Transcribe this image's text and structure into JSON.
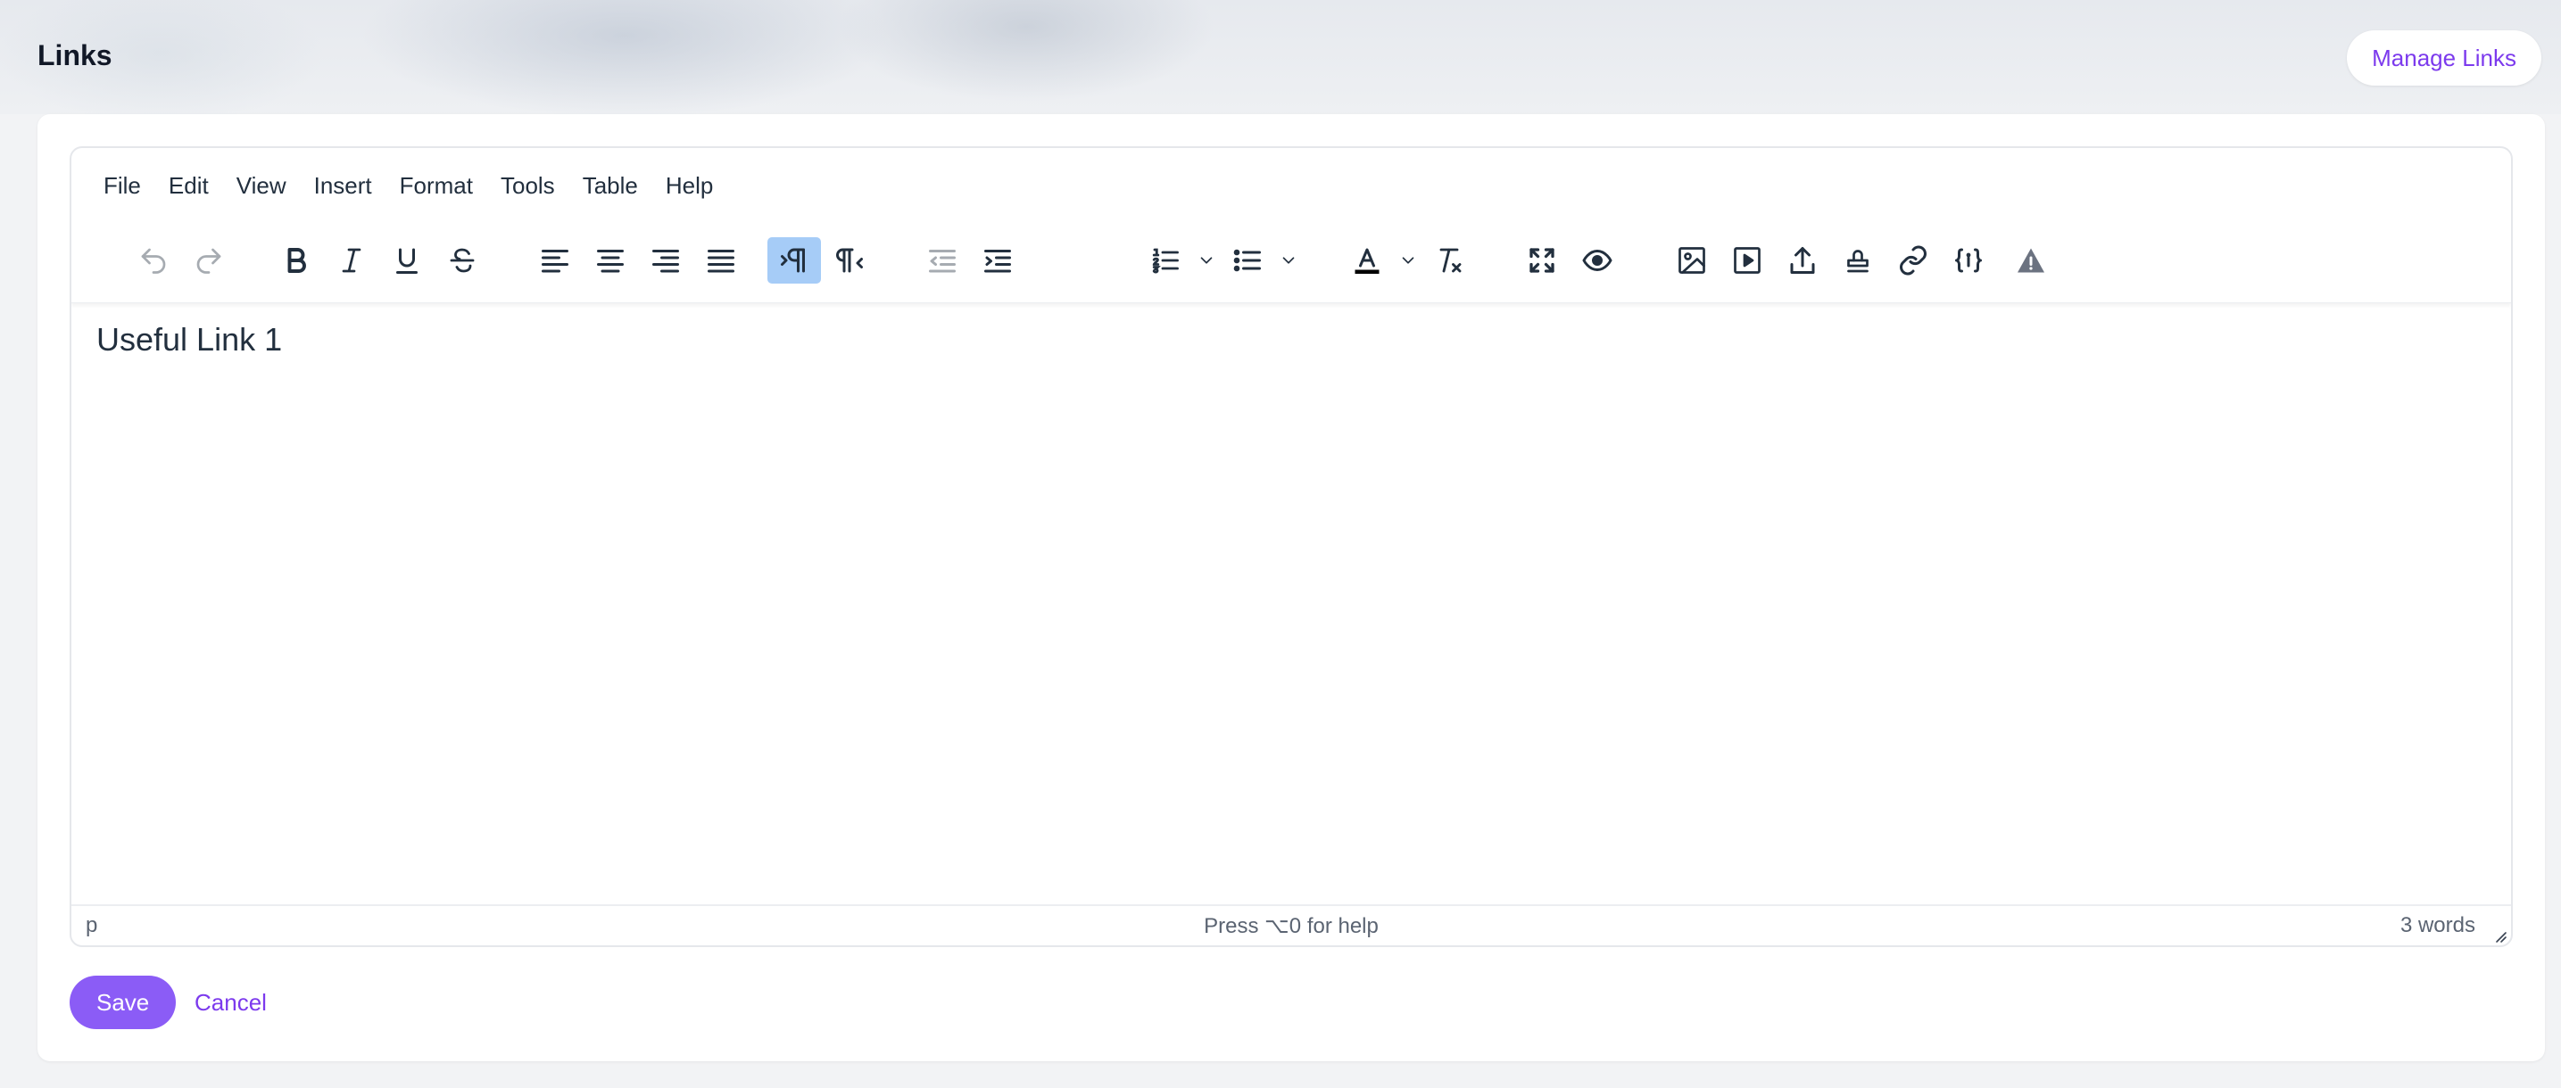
{
  "header": {
    "title": "Links",
    "manage_links_label": "Manage Links"
  },
  "editor": {
    "menu": [
      "File",
      "Edit",
      "View",
      "Insert",
      "Format",
      "Tools",
      "Table",
      "Help"
    ],
    "toolbar_icons": [
      "undo-icon",
      "redo-icon",
      "bold-icon",
      "italic-icon",
      "underline-icon",
      "strikethrough-icon",
      "align-left-icon",
      "align-center-icon",
      "align-right-icon",
      "justify-icon",
      "ltr-icon",
      "rtl-icon",
      "outdent-icon",
      "indent-icon",
      "numbered-list-icon",
      "bullet-list-icon",
      "text-color-icon",
      "clear-formatting-icon",
      "fullscreen-icon",
      "preview-icon",
      "image-icon",
      "media-icon",
      "upload-icon",
      "stamp-icon",
      "link-icon",
      "template-icon",
      "warning-icon"
    ],
    "active_tool": "ltr-icon",
    "content": "Useful Link 1",
    "status": {
      "path": "p",
      "help": "Press ⌥0 for help",
      "word_count": "3 words"
    }
  },
  "actions": {
    "save_label": "Save",
    "cancel_label": "Cancel"
  },
  "colors": {
    "accent": "#8b5cf6",
    "accent_text": "#7c3aed",
    "active_tool_bg": "#a6ccf7",
    "text_color_swatch": "#000000"
  }
}
